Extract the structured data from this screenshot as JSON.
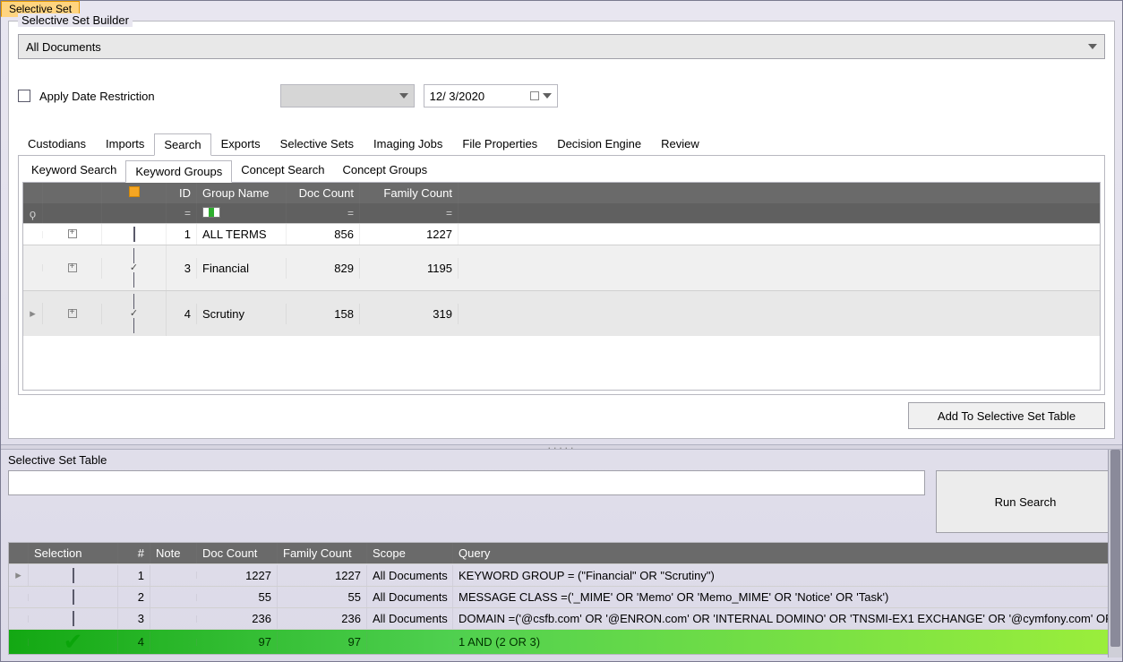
{
  "main_tab": "Selective Set",
  "builder": {
    "title": "Selective Set Builder",
    "scope": "All Documents",
    "apply_date_label": "Apply Date Restriction",
    "date_value": "12/ 3/2020",
    "tabs": [
      "Custodians",
      "Imports",
      "Search",
      "Exports",
      "Selective Sets",
      "Imaging Jobs",
      "File Properties",
      "Decision Engine",
      "Review"
    ],
    "active_tab": "Search",
    "subtabs": [
      "Keyword Search",
      "Keyword Groups",
      "Concept Search",
      "Concept Groups"
    ],
    "active_subtab": "Keyword Groups",
    "grid_headers": {
      "id": "ID",
      "name": "Group Name",
      "doc": "Doc Count",
      "fam": "Family Count"
    },
    "rows": [
      {
        "checked": false,
        "id": "1",
        "name": "ALL TERMS",
        "doc": "856",
        "fam": "1227"
      },
      {
        "checked": true,
        "id": "3",
        "name": "Financial",
        "doc": "829",
        "fam": "1195"
      },
      {
        "checked": true,
        "id": "4",
        "name": "Scrutiny",
        "doc": "158",
        "fam": "319"
      }
    ],
    "add_btn": "Add To Selective Set Table"
  },
  "table": {
    "title": "Selective Set Table",
    "run_btn": "Run Search",
    "headers": {
      "sel": "Selection",
      "num": "#",
      "note": "Note",
      "doc": "Doc Count",
      "fam": "Family Count",
      "scope": "Scope",
      "query": "Query"
    },
    "rows": [
      {
        "checked": false,
        "num": "1",
        "note": "",
        "doc": "1227",
        "fam": "1227",
        "scope": "All Documents",
        "query": "KEYWORD GROUP = (\"Financial\" OR \"Scrutiny\")"
      },
      {
        "checked": false,
        "num": "2",
        "note": "",
        "doc": "55",
        "fam": "55",
        "scope": "All Documents",
        "query": "MESSAGE CLASS =('_MIME' OR 'Memo' OR 'Memo_MIME' OR 'Notice' OR 'Task')"
      },
      {
        "checked": false,
        "num": "3",
        "note": "",
        "doc": "236",
        "fam": "236",
        "scope": "All Documents",
        "query": "DOMAIN =('@csfb.com' OR '@ENRON.com' OR 'INTERNAL DOMINO' OR 'TNSMI-EX1 EXCHANGE' OR '@cymfony.com' OR"
      },
      {
        "checked": true,
        "num": "4",
        "note": "",
        "doc": "97",
        "fam": "97",
        "scope": "",
        "query": "1 AND (2 OR 3)",
        "highlight": true
      }
    ]
  }
}
